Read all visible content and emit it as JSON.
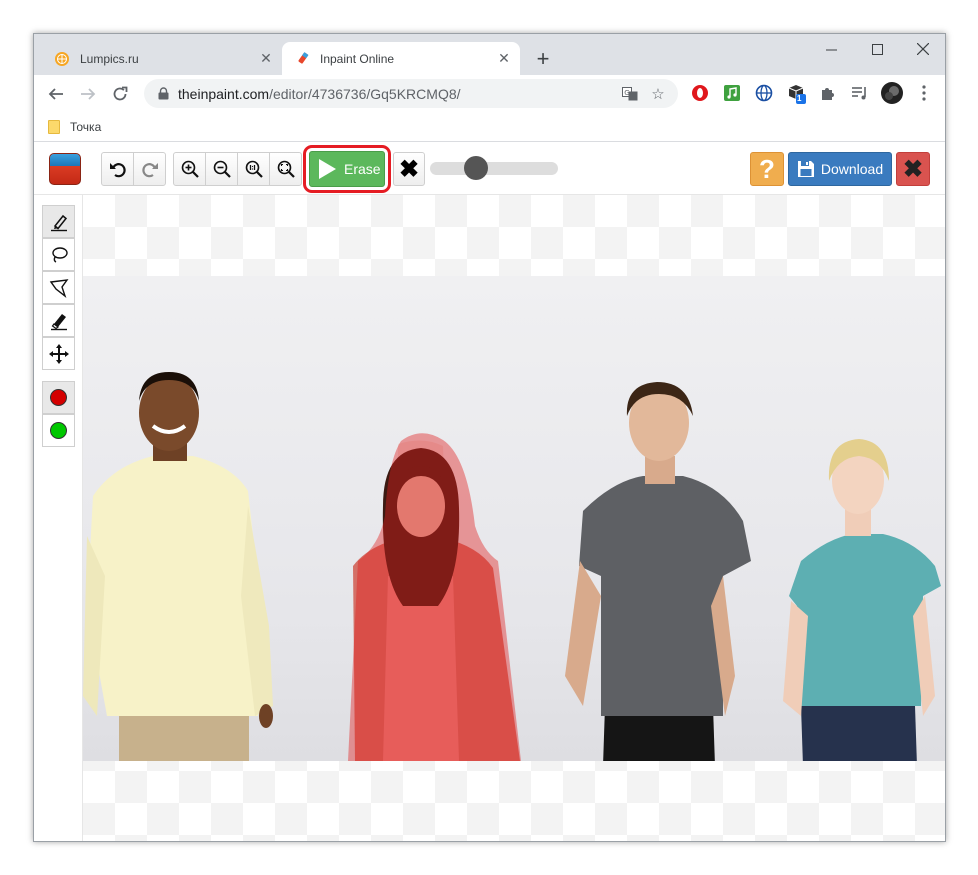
{
  "browser": {
    "tabs": [
      {
        "title": "Lumpics.ru",
        "active": false
      },
      {
        "title": "Inpaint Online",
        "active": true
      }
    ],
    "address": {
      "domain": "theinpaint.com",
      "path": "/editor/4736736/Gq5KRCMQ8/"
    },
    "bookmarks": [
      {
        "label": "Точка"
      }
    ],
    "extension_badge": "1"
  },
  "app": {
    "toolbar": {
      "erase_label": "Erase",
      "help_label": "?",
      "download_label": "Download",
      "brush_size": 0.33
    },
    "tools": [
      {
        "name": "marker",
        "selected": true
      },
      {
        "name": "lasso",
        "selected": false
      },
      {
        "name": "polygon-lasso",
        "selected": false
      },
      {
        "name": "eraser",
        "selected": false
      },
      {
        "name": "move",
        "selected": false
      }
    ],
    "swatches": [
      {
        "name": "red",
        "color": "#d40000",
        "selected": true
      },
      {
        "name": "green",
        "color": "#00c800",
        "selected": false
      }
    ]
  },
  "colors": {
    "erase_green": "#5cb85c",
    "highlight_red": "#e51c23",
    "help_orange": "#f0ad4e",
    "download_blue": "#3a7bbf",
    "close_red": "#d9534f"
  }
}
